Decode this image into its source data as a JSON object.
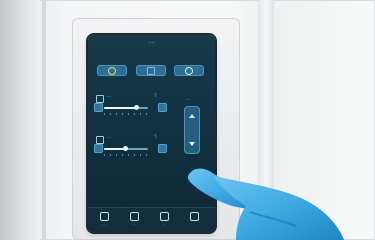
{
  "screen": {
    "title": "·· ··",
    "mode_buttons": [
      {
        "icon": "sun-icon"
      },
      {
        "icon": "square-icon"
      },
      {
        "icon": "circle-icon"
      }
    ],
    "control_rows": [
      {
        "label": "···",
        "aux": "·|",
        "level": 0.72
      },
      {
        "label": "···",
        "aux": "·|",
        "level": 0.48
      }
    ],
    "arrow_panel": {
      "caption": "··"
    },
    "nav_items": [
      {
        "label": "····",
        "icon": "home-icon"
      },
      {
        "label": "···",
        "icon": "chat-icon"
      },
      {
        "label": "··",
        "icon": "bell-icon"
      },
      {
        "label": "·",
        "icon": "settings-icon"
      }
    ]
  },
  "colors": {
    "screen_bg": "#11303f",
    "accent": "#2c6f92",
    "glove": "#3aa7e0"
  }
}
